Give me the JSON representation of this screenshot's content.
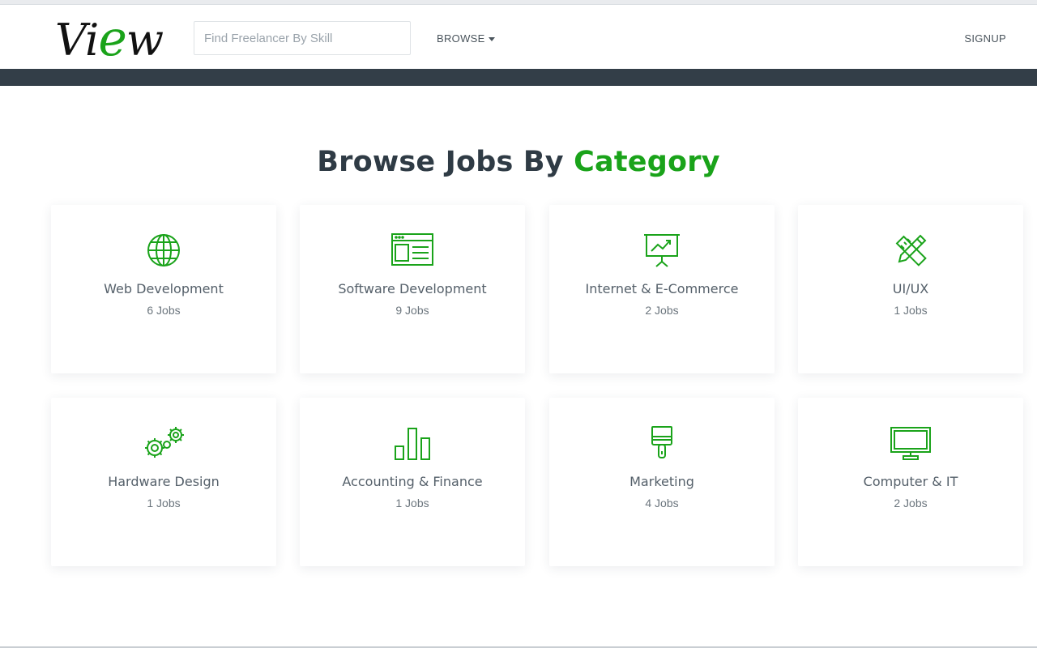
{
  "brand": {
    "logo_text_pre": "Vi",
    "logo_text_accent": "e",
    "logo_text_post": "w",
    "accent_color": "#1aa31a",
    "dark_color": "#333e48"
  },
  "header": {
    "search_placeholder": "Find Freelancer By Skill",
    "browse_label": "BROWSE",
    "signup_label": "SIGNUP"
  },
  "main": {
    "heading_pre": "Browse Jobs By",
    "heading_highlight": "Category",
    "categories": [
      {
        "name": "Web Development",
        "count": "6 Jobs",
        "icon": "globe-icon"
      },
      {
        "name": "Software Development",
        "count": "9 Jobs",
        "icon": "browser-window-icon"
      },
      {
        "name": "Internet & E-Commerce",
        "count": "2 Jobs",
        "icon": "presentation-chart-icon"
      },
      {
        "name": "UI/UX",
        "count": "1 Jobs",
        "icon": "pencil-ruler-icon"
      },
      {
        "name": "Hardware Design",
        "count": "1 Jobs",
        "icon": "gears-icon"
      },
      {
        "name": "Accounting & Finance",
        "count": "1 Jobs",
        "icon": "bar-chart-icon"
      },
      {
        "name": "Marketing",
        "count": "4 Jobs",
        "icon": "paint-brush-icon"
      },
      {
        "name": "Computer & IT",
        "count": "2 Jobs",
        "icon": "monitor-icon"
      }
    ]
  }
}
